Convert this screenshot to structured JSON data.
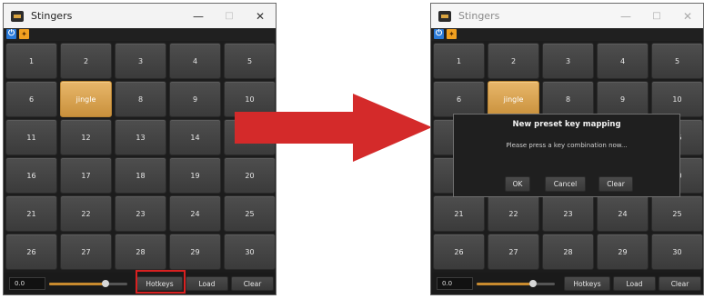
{
  "window": {
    "title": "Stingers",
    "controls": {
      "minimize": "—",
      "maximize": "□",
      "close": "✕"
    }
  },
  "toolbar": {
    "power_icon": "power-icon",
    "pin_icon": "pin-icon",
    "power_glyph": "⏻",
    "pin_glyph": "✦"
  },
  "grid": {
    "rows": [
      [
        "1",
        "2",
        "3",
        "4",
        "5"
      ],
      [
        "6",
        "jingle",
        "8",
        "9",
        "10"
      ],
      [
        "11",
        "12",
        "13",
        "14",
        "15"
      ],
      [
        "16",
        "17",
        "18",
        "19",
        "20"
      ],
      [
        "21",
        "22",
        "23",
        "24",
        "25"
      ],
      [
        "26",
        "27",
        "28",
        "29",
        "30"
      ]
    ],
    "active_label": "jingle"
  },
  "footer": {
    "volume_value": "0.0",
    "volume_level": 0.72,
    "hotkeys_label": "Hotkeys",
    "load_label": "Load",
    "clear_label": "Clear"
  },
  "dialog": {
    "title": "New preset key mapping",
    "message": "Please press a key combination now...",
    "ok_label": "OK",
    "cancel_label": "Cancel",
    "clear_label": "Clear"
  },
  "colors": {
    "accent": "#d9a441",
    "arrow": "#d42a2a",
    "highlight": "#d92020",
    "button": "#444444",
    "background": "#1c1c1c"
  }
}
